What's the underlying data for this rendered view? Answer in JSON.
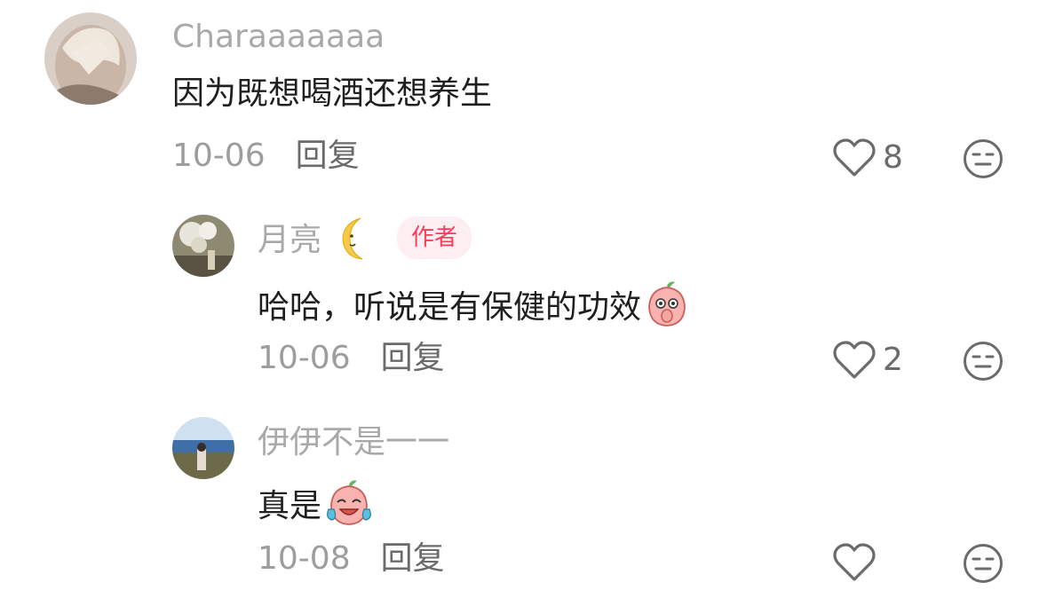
{
  "comments": [
    {
      "username": "Charaaaaaaa",
      "text": "因为既想喝酒还想养生",
      "date": "10-06",
      "reply_label": "回复",
      "like_count": "8"
    },
    {
      "username": "月亮",
      "username_emoji": "crescent-moon-icon",
      "badge": "作者",
      "text": "哈哈，听说是有保健的功效",
      "text_emoji": "peach-face-sticker-icon",
      "date": "10-06",
      "reply_label": "回复",
      "like_count": "2"
    },
    {
      "username": "伊伊不是一一",
      "text": "真是",
      "text_emoji": "peach-crying-laughing-sticker-icon",
      "date": "10-08",
      "reply_label": "回复",
      "like_count": ""
    }
  ],
  "colors": {
    "username": "#a9a9a9",
    "text": "#1f1f1f",
    "meta": "#9d9d9d",
    "badge_bg": "#fdeef1",
    "badge_text": "#ff3b5c",
    "icon": "#6b6b6b"
  }
}
